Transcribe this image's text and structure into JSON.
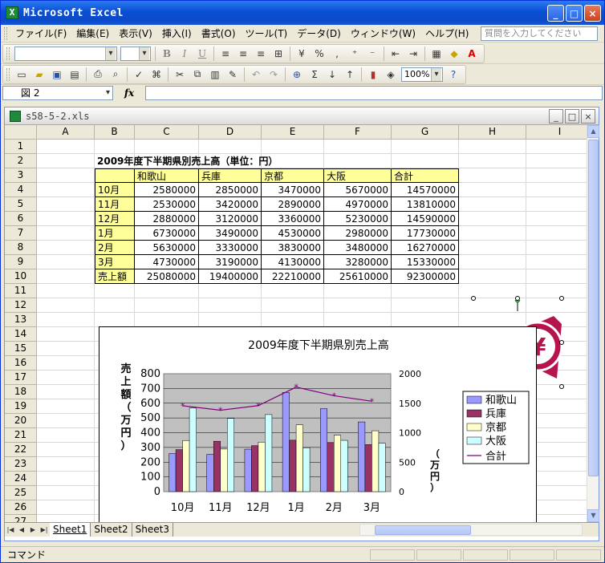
{
  "app": {
    "title": "Microsoft Excel",
    "title_icon": "X",
    "window_buttons": [
      "_",
      "□",
      "×"
    ]
  },
  "menu": {
    "items": [
      "ファイル(F)",
      "編集(E)",
      "表示(V)",
      "挿入(I)",
      "書式(O)",
      "ツール(T)",
      "データ(D)",
      "ウィンドウ(W)",
      "ヘルプ(H)"
    ],
    "help_placeholder": "質問を入力してください"
  },
  "toolbar": {
    "font_name": "",
    "font_size": "",
    "bold": "B",
    "italic": "I",
    "underline": "U",
    "zoom": "100%"
  },
  "formula_bar": {
    "name_box": "図 2",
    "fx": "fx",
    "formula": ""
  },
  "workbook": {
    "filename": "s58-5-2.xls",
    "columns": [
      "A",
      "B",
      "C",
      "D",
      "E",
      "F",
      "G",
      "H",
      "I"
    ],
    "rows": [
      "1",
      "2",
      "3",
      "4",
      "5",
      "6",
      "7",
      "8",
      "9",
      "10",
      "11",
      "12",
      "13",
      "14",
      "15",
      "16",
      "17",
      "18",
      "19",
      "20",
      "21",
      "22",
      "23",
      "24",
      "25",
      "26",
      "27"
    ]
  },
  "sheet": {
    "title": "2009年度下半期県別売上高（単位：円）",
    "header": [
      "",
      "和歌山",
      "兵庫",
      "京都",
      "大阪",
      "合計"
    ],
    "rows": [
      [
        "10月",
        "2580000",
        "2850000",
        "3470000",
        "5670000",
        "14570000"
      ],
      [
        "11月",
        "2530000",
        "3420000",
        "2890000",
        "4970000",
        "13810000"
      ],
      [
        "12月",
        "2880000",
        "3120000",
        "3360000",
        "5230000",
        "14590000"
      ],
      [
        "1月",
        "6730000",
        "3490000",
        "4530000",
        "2980000",
        "17730000"
      ],
      [
        "2月",
        "5630000",
        "3330000",
        "3830000",
        "3480000",
        "16270000"
      ],
      [
        "3月",
        "4730000",
        "3190000",
        "4130000",
        "3280000",
        "15330000"
      ],
      [
        "売上額",
        "25080000",
        "19400000",
        "22210000",
        "25610000",
        "92300000"
      ]
    ]
  },
  "tabs": {
    "sheets": [
      "Sheet1",
      "Sheet2",
      "Sheet3"
    ],
    "active": 0
  },
  "status": {
    "text": "コマンド"
  },
  "chart_data": {
    "type": "bar",
    "title": "2009年度下半期県別売上高",
    "ylabel": "売上額（万円）",
    "y2label": "（万円）",
    "categories": [
      "10月",
      "11月",
      "12月",
      "1月",
      "2月",
      "3月"
    ],
    "ylim": [
      0,
      800
    ],
    "yticks": [
      "0",
      "100",
      "200",
      "300",
      "400",
      "500",
      "600",
      "700",
      "800"
    ],
    "y2lim": [
      0,
      2000
    ],
    "y2ticks": [
      "0",
      "500",
      "1000",
      "1500",
      "2000"
    ],
    "series": [
      {
        "name": "和歌山",
        "values": [
          258,
          253,
          288,
          673,
          563,
          473
        ],
        "color": "#9999ff"
      },
      {
        "name": "兵庫",
        "values": [
          285,
          342,
          312,
          349,
          333,
          319
        ],
        "color": "#993366"
      },
      {
        "name": "京都",
        "values": [
          347,
          289,
          336,
          453,
          383,
          413
        ],
        "color": "#ffffcc"
      },
      {
        "name": "大阪",
        "values": [
          567,
          497,
          523,
          298,
          348,
          328
        ],
        "color": "#ccffff"
      }
    ],
    "line_series": {
      "name": "合計",
      "values": [
        1457,
        1381,
        1459,
        1773,
        1627,
        1533
      ],
      "color": "#800080",
      "axis": "secondary"
    },
    "legend": "right",
    "grid": true,
    "plot_bg": "#c0c0c0"
  },
  "logo": {
    "symbol": "¥",
    "color": "#b5144f",
    "name": "yen-logo"
  }
}
